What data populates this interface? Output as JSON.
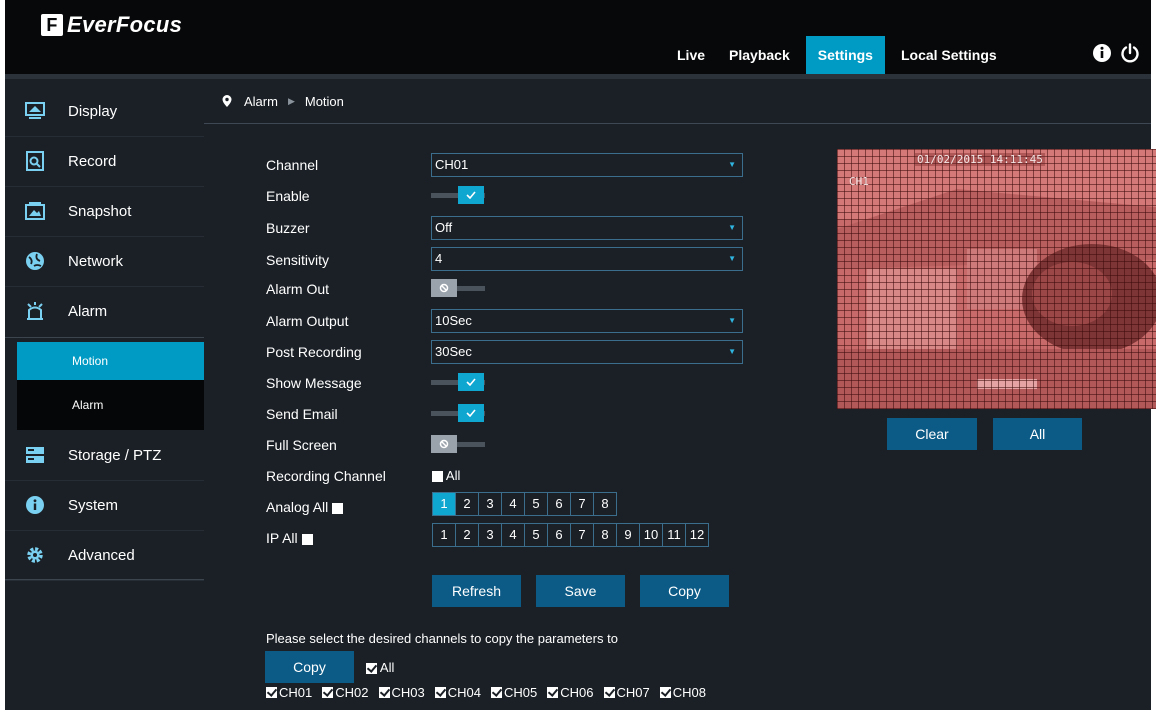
{
  "brand": {
    "name": "EverFocus",
    "mark": "F"
  },
  "nav": {
    "items": [
      {
        "label": "Live"
      },
      {
        "label": "Playback"
      },
      {
        "label": "Settings"
      },
      {
        "label": "Local Settings"
      }
    ],
    "active": "Settings"
  },
  "sidebar": {
    "items": [
      {
        "label": "Display",
        "icon": "monitor-icon"
      },
      {
        "label": "Record",
        "icon": "record-icon"
      },
      {
        "label": "Snapshot",
        "icon": "snapshot-icon"
      },
      {
        "label": "Network",
        "icon": "network-icon"
      },
      {
        "label": "Alarm",
        "icon": "alarm-icon"
      },
      {
        "label": "Storage / PTZ",
        "icon": "storage-icon"
      },
      {
        "label": "System",
        "icon": "info-icon"
      },
      {
        "label": "Advanced",
        "icon": "gear-icon"
      }
    ],
    "submenu": [
      {
        "label": "Motion",
        "active": true
      },
      {
        "label": "Alarm",
        "active": false
      }
    ]
  },
  "breadcrumb": {
    "section": "Alarm",
    "page": "Motion"
  },
  "form": {
    "channel": {
      "label": "Channel",
      "value": "CH01"
    },
    "enable": {
      "label": "Enable",
      "on": true
    },
    "buzzer": {
      "label": "Buzzer",
      "value": "Off"
    },
    "sensitivity": {
      "label": "Sensitivity",
      "value": "4"
    },
    "alarm_out": {
      "label": "Alarm Out",
      "on": false
    },
    "alarm_output": {
      "label": "Alarm Output",
      "value": "10Sec"
    },
    "post_recording": {
      "label": "Post Recording",
      "value": "30Sec"
    },
    "show_message": {
      "label": "Show Message",
      "on": true
    },
    "send_email": {
      "label": "Send Email",
      "on": true
    },
    "full_screen": {
      "label": "Full Screen",
      "on": false
    },
    "recording_channel": {
      "label": "Recording Channel",
      "all_label": "All"
    },
    "analog_all": {
      "label": "Analog All",
      "channels": [
        "1",
        "2",
        "3",
        "4",
        "5",
        "6",
        "7",
        "8"
      ],
      "selected": [
        "1"
      ]
    },
    "ip_all": {
      "label": "IP All",
      "channels": [
        "1",
        "2",
        "3",
        "4",
        "5",
        "6",
        "7",
        "8",
        "9",
        "10",
        "11",
        "12"
      ]
    }
  },
  "buttons": {
    "refresh": "Refresh",
    "save": "Save",
    "copy": "Copy",
    "clear": "Clear",
    "all": "All"
  },
  "preview": {
    "timestamp": "01/02/2015 14:11:45",
    "channel_osd": "CH1"
  },
  "copy_section": {
    "prompt": "Please select the desired channels to copy the parameters to",
    "copy_button": "Copy",
    "all_label": "All",
    "channels": [
      "CH01",
      "CH02",
      "CH03",
      "CH04",
      "CH05",
      "CH06",
      "CH07",
      "CH08"
    ]
  },
  "colors": {
    "accent": "#009bc4",
    "button": "#0c5b86",
    "panel": "#1b2026",
    "topbar": "#070809"
  }
}
